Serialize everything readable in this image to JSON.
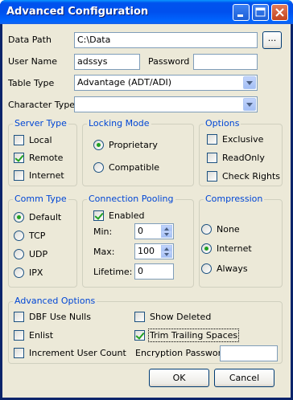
{
  "window": {
    "title": "Advanced Configuration"
  },
  "fields": {
    "data_path_label": "Data Path",
    "data_path_value": "C:\\Data",
    "browse_label": "...",
    "user_name_label": "User Name",
    "user_name_value": "adssys",
    "password_label": "Password",
    "password_value": "",
    "table_type_label": "Table Type",
    "table_type_value": "Advantage (ADT/ADI)",
    "character_type_label": "Character Type",
    "character_type_value": ""
  },
  "server_type": {
    "title": "Server Type",
    "items": [
      {
        "label": "Local",
        "checked": false
      },
      {
        "label": "Remote",
        "checked": true
      },
      {
        "label": "Internet",
        "checked": false
      }
    ]
  },
  "locking_mode": {
    "title": "Locking Mode",
    "items": [
      {
        "label": "Proprietary",
        "selected": true
      },
      {
        "label": "Compatible",
        "selected": false
      }
    ]
  },
  "options": {
    "title": "Options",
    "items": [
      {
        "label": "Exclusive",
        "checked": false
      },
      {
        "label": "ReadOnly",
        "checked": false
      },
      {
        "label": "Check Rights",
        "checked": false
      }
    ]
  },
  "comm_type": {
    "title": "Comm Type",
    "items": [
      {
        "label": "Default",
        "selected": true
      },
      {
        "label": "TCP",
        "selected": false
      },
      {
        "label": "UDP",
        "selected": false
      },
      {
        "label": "IPX",
        "selected": false
      }
    ]
  },
  "connection_pooling": {
    "title": "Connection Pooling",
    "enabled_label": "Enabled",
    "enabled": true,
    "min_label": "Min:",
    "min_value": "0",
    "max_label": "Max:",
    "max_value": "100",
    "lifetime_label": "Lifetime:",
    "lifetime_value": "0"
  },
  "compression": {
    "title": "Compression",
    "items": [
      {
        "label": "None",
        "selected": false
      },
      {
        "label": "Internet",
        "selected": true
      },
      {
        "label": "Always",
        "selected": false
      }
    ]
  },
  "advanced_options": {
    "title": "Advanced Options",
    "dbf_use_nulls": {
      "label": "DBF Use Nulls",
      "checked": false
    },
    "show_deleted": {
      "label": "Show Deleted",
      "checked": false
    },
    "enlist": {
      "label": "Enlist",
      "checked": false
    },
    "trim_trailing_spaces": {
      "label": "Trim Trailing Spaces",
      "checked": true
    },
    "increment_user_count": {
      "label": "Increment User Count",
      "checked": false
    },
    "encryption_password_label": "Encryption Password",
    "encryption_password_value": ""
  },
  "buttons": {
    "ok": "OK",
    "cancel": "Cancel"
  },
  "colors": {
    "title_bar": "#0054e3",
    "group_title": "#0046d5",
    "dialog_bg": "#ece9d8",
    "check_mark": "#21a121"
  },
  "icons": {
    "minimize": "minimize-icon",
    "maximize": "maximize-icon",
    "close": "close-icon"
  }
}
